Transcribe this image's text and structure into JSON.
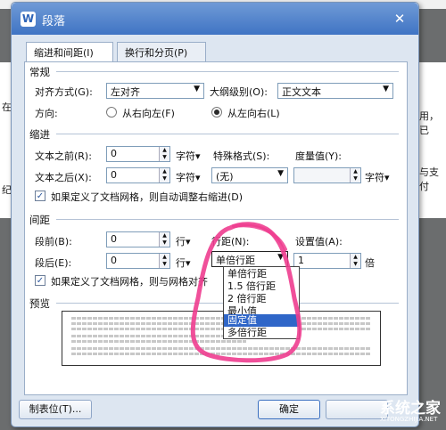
{
  "dialog": {
    "title": "段落",
    "title_icon": "W",
    "close_icon": "✕"
  },
  "background": {
    "frags": [
      "在",
      "1",
      "用，已",
      "与支付",
      "纪"
    ]
  },
  "tabs": [
    {
      "label": "缩进和间距(I)"
    },
    {
      "label": "换行和分页(P)"
    }
  ],
  "general": {
    "heading": "常规",
    "alignment_label": "对齐方式(G):",
    "alignment_value": "左对齐",
    "outline_label": "大纲级别(O):",
    "outline_value": "正文文本",
    "direction_label": "方向:",
    "rtl_label": "从右向左(F)",
    "ltr_label": "从左向右(L)"
  },
  "indent": {
    "heading": "缩进",
    "before_label": "文本之前(R):",
    "before_value": "0",
    "before_unit": "字符▾",
    "special_label": "特殊格式(S):",
    "special_value": "(无)",
    "measure_label": "度量值(Y):",
    "measure_unit": "字符▾",
    "after_label": "文本之后(X):",
    "after_value": "0",
    "after_unit": "字符▾",
    "grid_check_label": "如果定义了文档网格，则自动调整右缩进(D)"
  },
  "spacing": {
    "heading": "间距",
    "before_label": "段前(B):",
    "before_value": "0",
    "before_unit": "行▾",
    "line_label": "行距(N):",
    "line_value": "单倍行距",
    "setting_label": "设置值(A):",
    "setting_value": "1",
    "setting_unit": "倍",
    "after_label": "段后(E):",
    "after_value": "0",
    "after_unit": "行▾",
    "grid_check_label": "如果定义了文档网格，则与网格对齐"
  },
  "line_spacing_options": [
    {
      "label": "单倍行距"
    },
    {
      "label": "1.5 倍行距"
    },
    {
      "label": "2 倍行距"
    },
    {
      "label": "最小值"
    },
    {
      "label": "固定值"
    },
    {
      "label": "多倍行距"
    }
  ],
  "selected_option": "固定值",
  "preview": {
    "heading": "预览"
  },
  "buttons": {
    "tabs_label": "制表位(T)...",
    "ok_label": "确定"
  },
  "watermark": {
    "main": "系统之家",
    "sub": "XITONGZHIJIA.NET"
  },
  "colors": {
    "titlebar": "#3f74c4",
    "dialog_bg": "#dde6f1",
    "selection": "#2f66c8",
    "annotation": "#ee3d8f"
  }
}
